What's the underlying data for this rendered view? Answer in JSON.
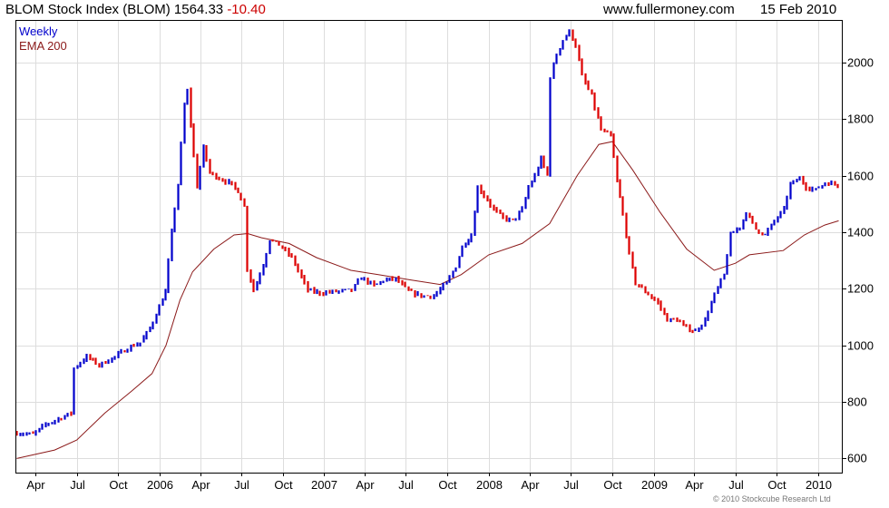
{
  "header": {
    "index_name": "BLOM Stock Index (BLOM)",
    "last_price": "1564.33",
    "change": "-10.40",
    "website": "www.fullermoney.com",
    "date": "15 Feb 2010"
  },
  "footer": {
    "copyright": "© 2010 Stockcube Research Ltd"
  },
  "colors": {
    "up": "#0000cc",
    "down": "#dd0000",
    "ema": "#8b1a1a",
    "grid": "#dddddd",
    "axis": "#000000"
  },
  "chart_data": {
    "type": "ohlc",
    "title": "BLOM Stock Index (BLOM)",
    "xlabel": "",
    "ylabel": "",
    "ylim": [
      550,
      2150
    ],
    "grid": true,
    "y_axis_side": "right",
    "legend": {
      "placement": "top-left",
      "entries": [
        {
          "label": "Weekly",
          "color": "#0000cc"
        },
        {
          "label": "EMA 200",
          "color": "#8b1a1a"
        }
      ]
    },
    "y_ticks": [
      600,
      800,
      1000,
      1200,
      1400,
      1600,
      1800,
      2000
    ],
    "x_ticks": [
      {
        "label": "Apr",
        "date": "2005-04-01"
      },
      {
        "label": "Jul",
        "date": "2005-07-01"
      },
      {
        "label": "Oct",
        "date": "2005-10-01"
      },
      {
        "label": "2006",
        "date": "2006-01-01"
      },
      {
        "label": "Apr",
        "date": "2006-04-01"
      },
      {
        "label": "Jul",
        "date": "2006-07-01"
      },
      {
        "label": "Oct",
        "date": "2006-10-01"
      },
      {
        "label": "2007",
        "date": "2007-01-01"
      },
      {
        "label": "Apr",
        "date": "2007-04-01"
      },
      {
        "label": "Jul",
        "date": "2007-07-01"
      },
      {
        "label": "Oct",
        "date": "2007-10-01"
      },
      {
        "label": "2008",
        "date": "2008-01-01"
      },
      {
        "label": "Apr",
        "date": "2008-04-01"
      },
      {
        "label": "Jul",
        "date": "2008-07-01"
      },
      {
        "label": "Oct",
        "date": "2008-10-01"
      },
      {
        "label": "2009",
        "date": "2009-01-01"
      },
      {
        "label": "Apr",
        "date": "2009-04-01"
      },
      {
        "label": "Jul",
        "date": "2009-07-01"
      },
      {
        "label": "Oct",
        "date": "2009-10-01"
      },
      {
        "label": "2010",
        "date": "2010-01-01"
      }
    ],
    "x_range": [
      "2005-02-15",
      "2010-02-22"
    ],
    "weekly_close_anchors": [
      [
        "2005-02-18",
        690
      ],
      [
        "2005-03-25",
        685
      ],
      [
        "2005-04-22",
        720
      ],
      [
        "2005-05-27",
        745
      ],
      [
        "2005-06-17",
        760
      ],
      [
        "2005-06-24",
        920
      ],
      [
        "2005-07-22",
        960
      ],
      [
        "2005-08-19",
        930
      ],
      [
        "2005-09-23",
        960
      ],
      [
        "2005-10-21",
        990
      ],
      [
        "2005-11-18",
        1010
      ],
      [
        "2005-12-09",
        1060
      ],
      [
        "2006-01-13",
        1190
      ],
      [
        "2006-01-27",
        1400
      ],
      [
        "2006-02-10",
        1570
      ],
      [
        "2006-02-24",
        1850
      ],
      [
        "2006-03-03",
        1900
      ],
      [
        "2006-03-10",
        1780
      ],
      [
        "2006-03-24",
        1560
      ],
      [
        "2006-04-07",
        1700
      ],
      [
        "2006-04-21",
        1610
      ],
      [
        "2006-05-12",
        1590
      ],
      [
        "2006-06-02",
        1575
      ],
      [
        "2006-06-23",
        1545
      ],
      [
        "2006-07-07",
        1490
      ],
      [
        "2006-07-14",
        1270
      ],
      [
        "2006-07-28",
        1195
      ],
      [
        "2006-08-18",
        1285
      ],
      [
        "2006-09-01",
        1375
      ],
      [
        "2006-09-22",
        1355
      ],
      [
        "2006-10-20",
        1310
      ],
      [
        "2006-11-10",
        1240
      ],
      [
        "2006-11-24",
        1195
      ],
      [
        "2006-12-22",
        1185
      ],
      [
        "2007-01-26",
        1190
      ],
      [
        "2007-03-02",
        1195
      ],
      [
        "2007-03-23",
        1240
      ],
      [
        "2007-04-20",
        1210
      ],
      [
        "2007-05-11",
        1230
      ],
      [
        "2007-06-08",
        1235
      ],
      [
        "2007-07-06",
        1190
      ],
      [
        "2007-08-03",
        1175
      ],
      [
        "2007-08-31",
        1175
      ],
      [
        "2007-09-28",
        1220
      ],
      [
        "2007-10-19",
        1280
      ],
      [
        "2007-11-02",
        1350
      ],
      [
        "2007-11-23",
        1390
      ],
      [
        "2007-12-07",
        1560
      ],
      [
        "2007-12-21",
        1530
      ],
      [
        "2008-01-11",
        1480
      ],
      [
        "2008-02-01",
        1450
      ],
      [
        "2008-02-22",
        1440
      ],
      [
        "2008-03-14",
        1480
      ],
      [
        "2008-03-28",
        1560
      ],
      [
        "2008-04-11",
        1600
      ],
      [
        "2008-04-25",
        1660
      ],
      [
        "2008-05-09",
        1600
      ],
      [
        "2008-05-16",
        1950
      ],
      [
        "2008-05-30",
        2030
      ],
      [
        "2008-06-13",
        2080
      ],
      [
        "2008-06-27",
        2110
      ],
      [
        "2008-07-11",
        2060
      ],
      [
        "2008-07-25",
        1950
      ],
      [
        "2008-08-15",
        1880
      ],
      [
        "2008-09-05",
        1760
      ],
      [
        "2008-09-26",
        1740
      ],
      [
        "2008-10-10",
        1580
      ],
      [
        "2008-10-24",
        1460
      ],
      [
        "2008-11-07",
        1320
      ],
      [
        "2008-11-21",
        1220
      ],
      [
        "2008-12-12",
        1190
      ],
      [
        "2009-01-09",
        1150
      ],
      [
        "2009-01-30",
        1090
      ],
      [
        "2009-02-20",
        1090
      ],
      [
        "2009-03-13",
        1060
      ],
      [
        "2009-04-03",
        1050
      ],
      [
        "2009-04-24",
        1090
      ],
      [
        "2009-05-15",
        1180
      ],
      [
        "2009-06-05",
        1250
      ],
      [
        "2009-06-19",
        1390
      ],
      [
        "2009-07-10",
        1420
      ],
      [
        "2009-07-24",
        1470
      ],
      [
        "2009-08-14",
        1410
      ],
      [
        "2009-09-04",
        1390
      ],
      [
        "2009-09-25",
        1440
      ],
      [
        "2009-10-16",
        1480
      ],
      [
        "2009-10-30",
        1570
      ],
      [
        "2009-11-20",
        1590
      ],
      [
        "2009-12-04",
        1560
      ],
      [
        "2009-12-25",
        1550
      ],
      [
        "2010-01-15",
        1575
      ],
      [
        "2010-02-05",
        1570
      ],
      [
        "2010-02-12",
        1564.33
      ]
    ],
    "ema_200_anchors": [
      [
        "2005-02-18",
        600
      ],
      [
        "2005-05-13",
        630
      ],
      [
        "2005-07-01",
        665
      ],
      [
        "2005-09-01",
        760
      ],
      [
        "2005-11-01",
        840
      ],
      [
        "2005-12-15",
        900
      ],
      [
        "2006-01-15",
        1000
      ],
      [
        "2006-02-15",
        1160
      ],
      [
        "2006-03-15",
        1260
      ],
      [
        "2006-05-01",
        1340
      ],
      [
        "2006-06-15",
        1390
      ],
      [
        "2006-07-15",
        1395
      ],
      [
        "2006-08-15",
        1380
      ],
      [
        "2006-10-15",
        1360
      ],
      [
        "2006-12-15",
        1310
      ],
      [
        "2007-03-01",
        1265
      ],
      [
        "2007-05-01",
        1250
      ],
      [
        "2007-07-15",
        1230
      ],
      [
        "2007-09-15",
        1215
      ],
      [
        "2007-11-01",
        1250
      ],
      [
        "2008-01-01",
        1320
      ],
      [
        "2008-03-15",
        1360
      ],
      [
        "2008-05-15",
        1430
      ],
      [
        "2008-07-15",
        1600
      ],
      [
        "2008-09-01",
        1710
      ],
      [
        "2008-10-01",
        1720
      ],
      [
        "2008-11-15",
        1620
      ],
      [
        "2009-01-15",
        1470
      ],
      [
        "2009-03-15",
        1340
      ],
      [
        "2009-05-15",
        1265
      ],
      [
        "2009-07-01",
        1290
      ],
      [
        "2009-08-01",
        1320
      ],
      [
        "2009-10-15",
        1335
      ],
      [
        "2009-12-01",
        1390
      ],
      [
        "2010-01-15",
        1425
      ],
      [
        "2010-02-15",
        1440
      ]
    ]
  }
}
